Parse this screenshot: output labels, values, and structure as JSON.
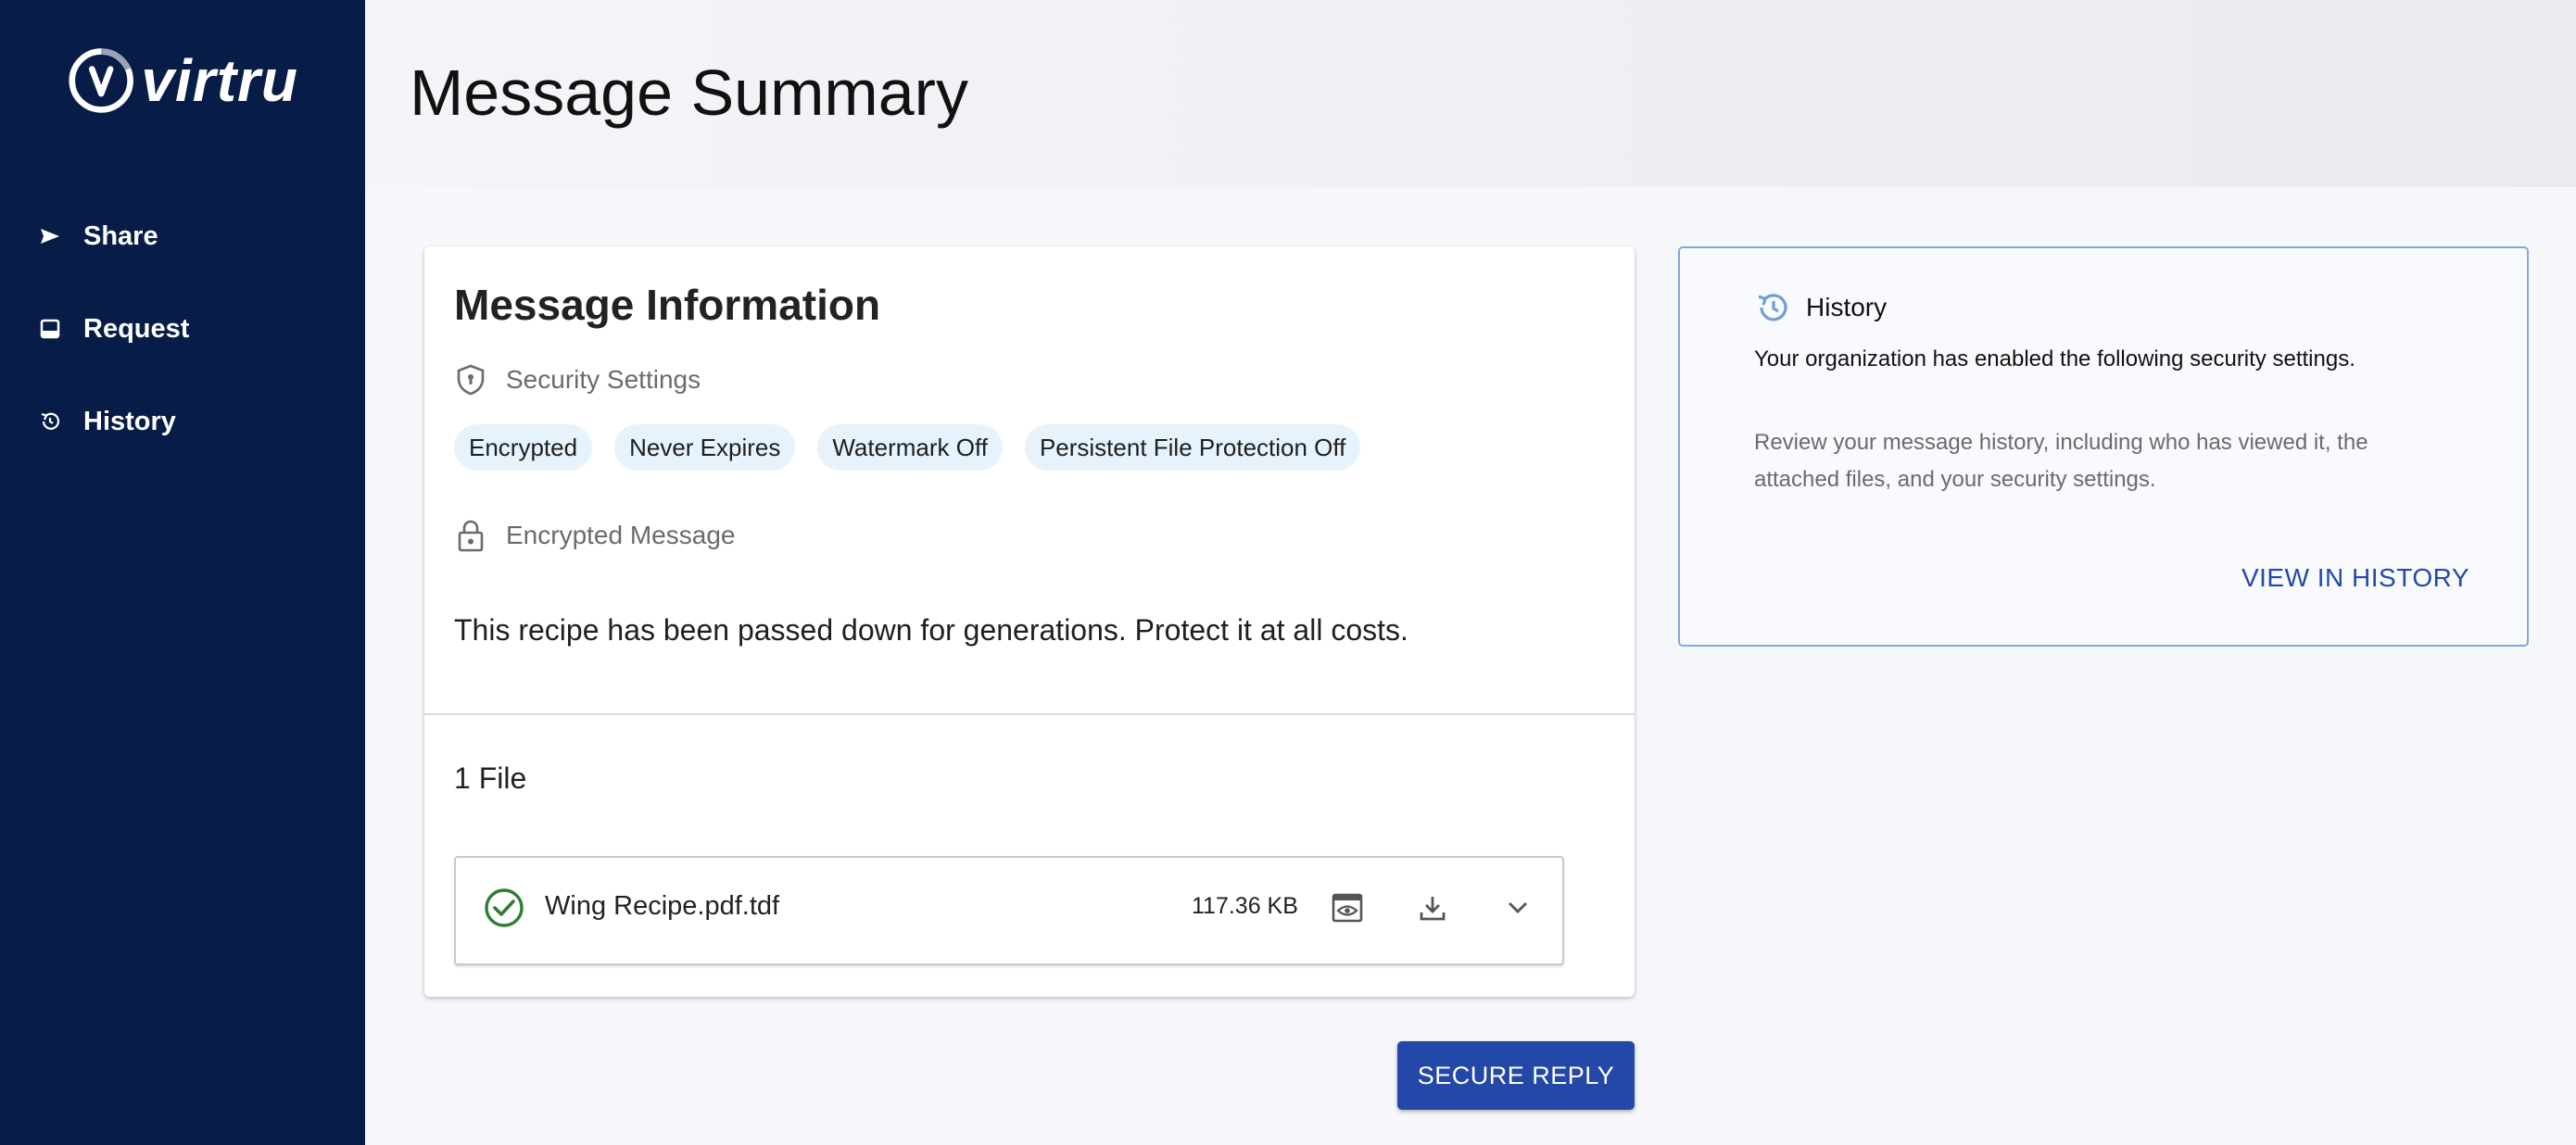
{
  "brand": {
    "name": "virtru"
  },
  "sidebar": {
    "items": [
      {
        "label": "Share",
        "icon": "send-icon"
      },
      {
        "label": "Request",
        "icon": "inbox-icon"
      },
      {
        "label": "History",
        "icon": "history-icon"
      }
    ]
  },
  "header": {
    "title": "Message Summary"
  },
  "message_card": {
    "title": "Message Information",
    "security_settings_label": "Security Settings",
    "chips": [
      "Encrypted",
      "Never Expires",
      "Watermark Off",
      "Persistent File Protection Off"
    ],
    "encrypted_message_label": "Encrypted Message",
    "body": "This recipe has been passed down for generations. Protect it at all costs.",
    "files_count": "1 File",
    "files": [
      {
        "name": "Wing Recipe.pdf.tdf",
        "size": "117.36 KB",
        "status": "check-circle-icon"
      }
    ]
  },
  "actions": {
    "secure_reply": "SECURE REPLY"
  },
  "history_card": {
    "title": "History",
    "description": "Your organization has enabled the following security settings.",
    "detail": "Review your message history, including who has viewed it, the attached files, and your security settings.",
    "link": "VIEW IN HISTORY"
  },
  "colors": {
    "sidebar_bg": "#071d48",
    "primary": "#2448a8",
    "chip_bg": "#e7f3fc",
    "success": "#2e7d32",
    "history_border": "#7ea9dd"
  }
}
